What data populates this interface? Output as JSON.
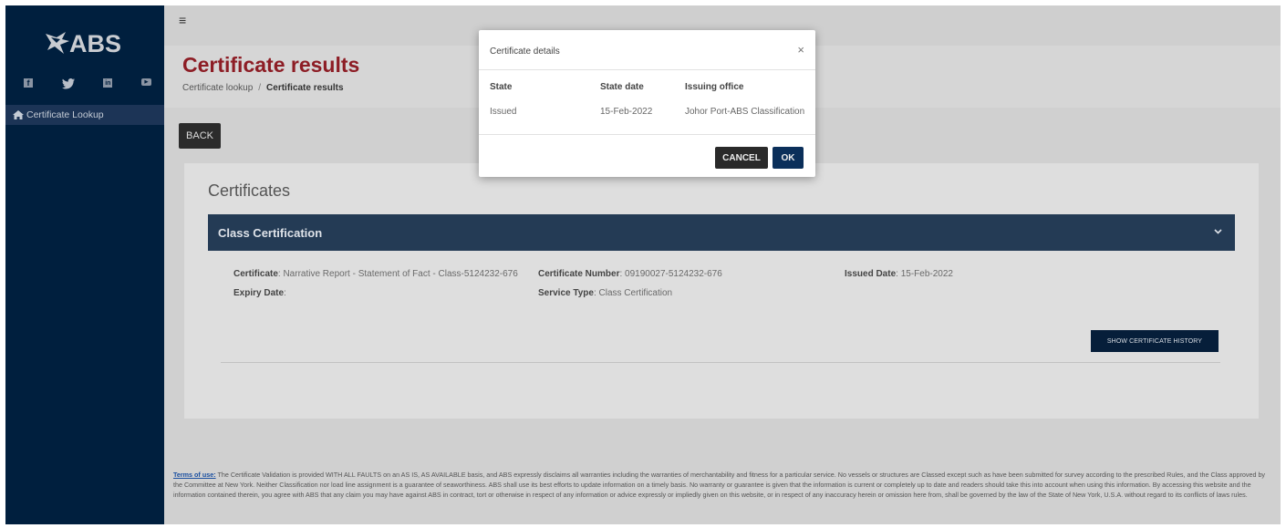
{
  "brand": {
    "logo_text": "ABS"
  },
  "sidebar": {
    "social_icons": [
      "facebook-icon",
      "twitter-icon",
      "linkedin-icon",
      "youtube-icon"
    ],
    "nav_items": [
      {
        "label": "Certificate Lookup",
        "icon": "home-icon"
      }
    ]
  },
  "header": {
    "menu_icon": "hamburger-icon",
    "page_title": "Certificate results",
    "breadcrumb": {
      "parent": "Certificate lookup",
      "separator": "/",
      "current": "Certificate results"
    }
  },
  "toolbar": {
    "back_label": "BACK"
  },
  "certificates": {
    "section_title": "Certificates",
    "accordion_title": "Class Certification",
    "fields": {
      "certificate_label": "Certificate",
      "certificate_value": ": Narrative Report - Statement of Fact - Class-5124232-676",
      "number_label": "Certificate Number",
      "number_value": ": 09190027-5124232-676",
      "issued_label": "Issued Date",
      "issued_value": ": 15-Feb-2022",
      "expiry_label": "Expiry Date",
      "expiry_value": ":",
      "service_label": "Service Type",
      "service_value": ": Class Certification"
    },
    "history_button": "SHOW CERTIFICATE HISTORY"
  },
  "terms": {
    "link": "Terms of use:",
    "text": " The Certificate Validation is provided WITH ALL FAULTS on an AS IS, AS AVAILABLE basis, and ABS expressly disclaims all warranties including the warranties of merchantability and fitness for a particular service. No vessels or structures are Classed except such as have been submitted for survey according to the prescribed Rules, and the Class approved by the Committee at New York. Neither Classification nor load line assignment is a guarantee of seaworthiness. ABS shall use its best efforts to update information on a timely basis. No warranty or guarantee is given that the information is current or completely up to date and readers should take this into account when using this information. By accessing this website and the information contained therein, you agree with ABS that any claim you may have against ABS in contract, tort or otherwise in respect of any information or advice expressly or impliedly given on this website, or in respect of any inaccuracy herein or omission here from, shall be governed by the law of the State of New York, U.S.A. without regard to its conflicts of laws rules."
  },
  "modal": {
    "title": "Certificate details",
    "close": "×",
    "columns": [
      "State",
      "State date",
      "Issuing office"
    ],
    "row": [
      "Issued",
      "15-Feb-2022",
      "Johor Port-ABS Classification"
    ],
    "cancel_label": "CANCEL",
    "ok_label": "OK"
  },
  "colors": {
    "sidebar": "#001f3e",
    "title": "#8d1d25",
    "accordion": "#243b55",
    "primary_button": "#0b2f5a"
  }
}
